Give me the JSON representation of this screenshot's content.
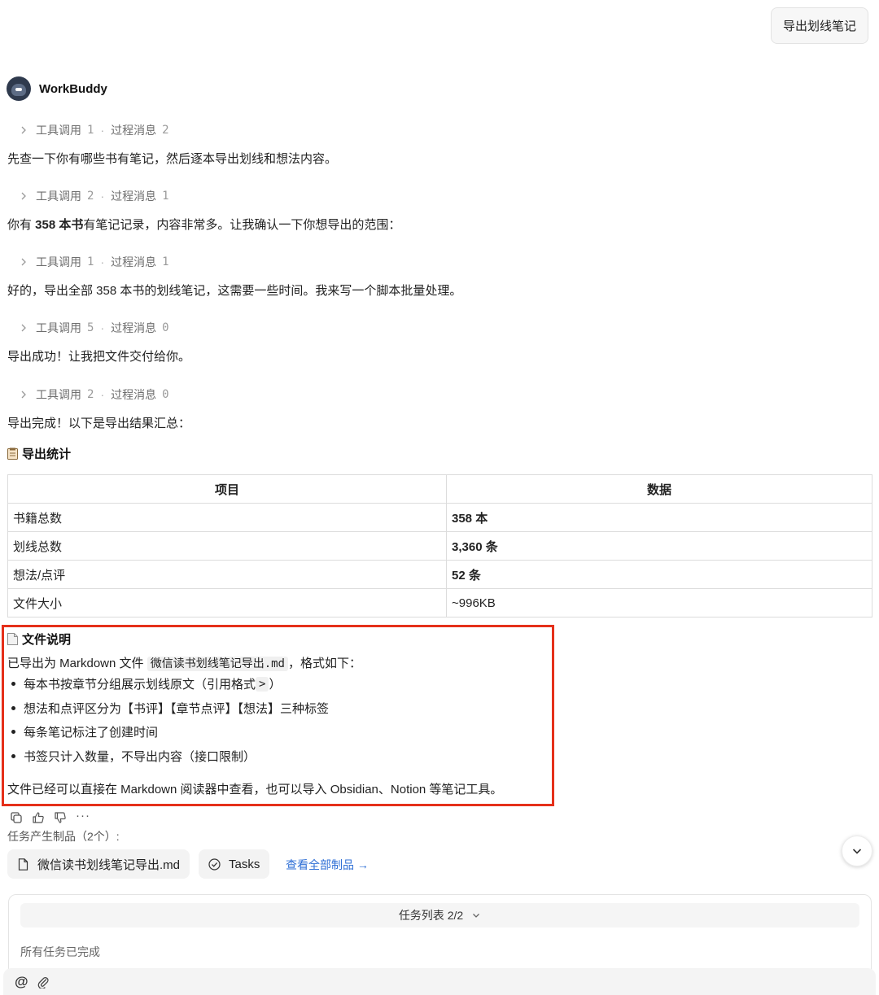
{
  "header": {
    "export_button": "导出划线笔记"
  },
  "bot": {
    "name": "WorkBuddy"
  },
  "steps": [
    {
      "tool_label": "工具调用",
      "tool_count": "1",
      "process_label": "过程消息",
      "process_count": "2",
      "message": "先查一下你有哪些书有笔记，然后逐本导出划线和想法内容。"
    },
    {
      "tool_label": "工具调用",
      "tool_count": "2",
      "process_label": "过程消息",
      "process_count": "1",
      "message_pre": "你有 ",
      "message_bold": "358 本书",
      "message_post": "有笔记记录，内容非常多。让我确认一下你想导出的范围："
    },
    {
      "tool_label": "工具调用",
      "tool_count": "1",
      "process_label": "过程消息",
      "process_count": "1",
      "message": "好的，导出全部 358 本书的划线笔记，这需要一些时间。我来写一个脚本批量处理。"
    },
    {
      "tool_label": "工具调用",
      "tool_count": "5",
      "process_label": "过程消息",
      "process_count": "0",
      "message": "导出成功！让我把文件交付给你。"
    },
    {
      "tool_label": "工具调用",
      "tool_count": "2",
      "process_label": "过程消息",
      "process_count": "0",
      "message": "导出完成！以下是导出结果汇总："
    }
  ],
  "stats": {
    "title": "导出统计",
    "headers": [
      "项目",
      "数据"
    ],
    "rows": [
      {
        "item": "书籍总数",
        "value": "358 本"
      },
      {
        "item": "划线总数",
        "value": "3,360 条"
      },
      {
        "item": "想法/点评",
        "value": "52 条"
      },
      {
        "item": "文件大小",
        "value": "~996KB"
      }
    ]
  },
  "file_info": {
    "title": "文件说明",
    "intro_pre": "已导出为 Markdown 文件 ",
    "file_name": "微信读书划线笔记导出.md",
    "intro_post": "，格式如下：",
    "bullet1_pre": "每本书按章节分组展示划线原文（引用格式 ",
    "bullet1_code": ">",
    "bullet1_post": "）",
    "bullet2": "想法和点评区分为【书评】【章节点评】【想法】三种标签",
    "bullet3": "每条笔记标注了创建时间",
    "bullet4": "书签只计入数量，不导出内容（接口限制）",
    "footer": "文件已经可以直接在 Markdown 阅读器中查看，也可以导入 Obsidian、Notion 等笔记工具。"
  },
  "actions": {
    "more": "···"
  },
  "artifacts": {
    "label": "任务产生制品（2个）:",
    "file_chip": "微信读书划线笔记导出.md",
    "tasks_chip": "Tasks",
    "view_all": "查看全部制品 →"
  },
  "task_panel": {
    "header": "任务列表 2/2",
    "status": "所有任务已完成"
  },
  "input": {
    "at_symbol": "@"
  },
  "colors": {
    "highlight_border": "#e5301a",
    "link": "#2f6fd6"
  }
}
